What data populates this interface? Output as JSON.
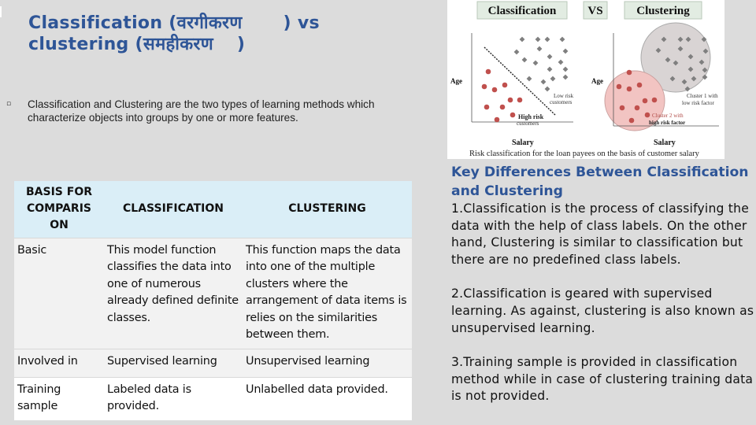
{
  "slide": {
    "title_line1_a": "Classification (वरगीकरण",
    "title_line1_b": ") vs",
    "title_line2_a": "clustering (समहीकरण",
    "title_line2_b": ")",
    "intro_bullet": "▫",
    "intro_text": "Classification and Clustering are the two types of learning methods which characterize objects into groups by one or more features."
  },
  "table": {
    "headers": [
      "BASIS FOR COMPARIS ON",
      "CLASSIFICATION",
      "CLUSTERING"
    ],
    "rows": [
      {
        "basis": "Basic",
        "classification": "This model function classifies the data into one of numerous already defined definite classes.",
        "clustering": "This function maps the data into one of the multiple clusters where the arrangement of data items is relies on the similarities between them."
      },
      {
        "basis": "Involved in",
        "classification": "Supervised learning",
        "clustering": "Unsupervised learning"
      },
      {
        "basis": "Training sample",
        "classification": "Labeled data is provided.",
        "clustering": "Unlabelled data provided."
      }
    ]
  },
  "diagram": {
    "label_classification": "Classification",
    "label_vs": "VS",
    "label_clustering": "Clustering",
    "axis_y": "Age",
    "axis_x": "Salary",
    "low_risk_line1": "Low risk",
    "low_risk_line2": "customers",
    "high_risk_line1": "High risk",
    "high_risk_line2": "customers",
    "cluster1_line1": "Cluster 1 with",
    "cluster1_line2": "low risk factor",
    "cluster2_line1": "Cluster 2 with",
    "cluster2_line2": "high risk factor",
    "caption": "Risk classification for the loan payees on the basis of customer salary",
    "colors": {
      "high_risk": "#c0504d",
      "low_risk": "#7f7f7f",
      "cluster_red_fill": "#f2c4c2",
      "cluster_gray_fill": "#d9d4d4",
      "label_box": "#e2ece2"
    }
  },
  "key_differences": {
    "heading": "Key Differences Between Classification and Clustering",
    "points": [
      "1.Classification is the process of classifying the data with the help of class labels. On the other hand, Clustering is similar to classification but there are no predefined class labels.",
      "2.Classification is geared with supervised learning. As against, clustering is also known as unsupervised learning.",
      "3.Training sample is provided in classification method while in case of clustering training data is not provided."
    ]
  },
  "colors": {
    "title": "#2e5597",
    "background": "#dcdcdc",
    "table_header": "#daeef7",
    "row_shade": "#f2f2f2"
  }
}
